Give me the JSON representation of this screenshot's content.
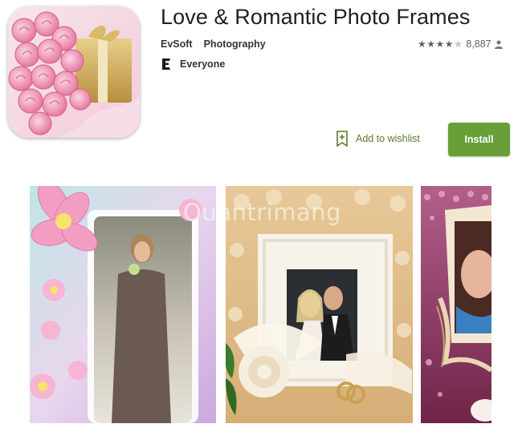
{
  "app": {
    "title": "Love & Romantic Photo Frames",
    "developer": "EvSoft",
    "category": "Photography",
    "content_rating": "Everyone",
    "rating_stars": 4,
    "review_count": "8,887"
  },
  "actions": {
    "wishlist_label": "Add to wishlist",
    "install_label": "Install"
  },
  "watermark": "Quantrimang",
  "colors": {
    "install_green": "#689f38",
    "wishlist_green": "#5b7b29",
    "text_primary": "#212121"
  },
  "icons": [
    "app-icon",
    "content-rating-e-icon",
    "star-icon",
    "person-icon",
    "bookmark-plus-icon"
  ]
}
